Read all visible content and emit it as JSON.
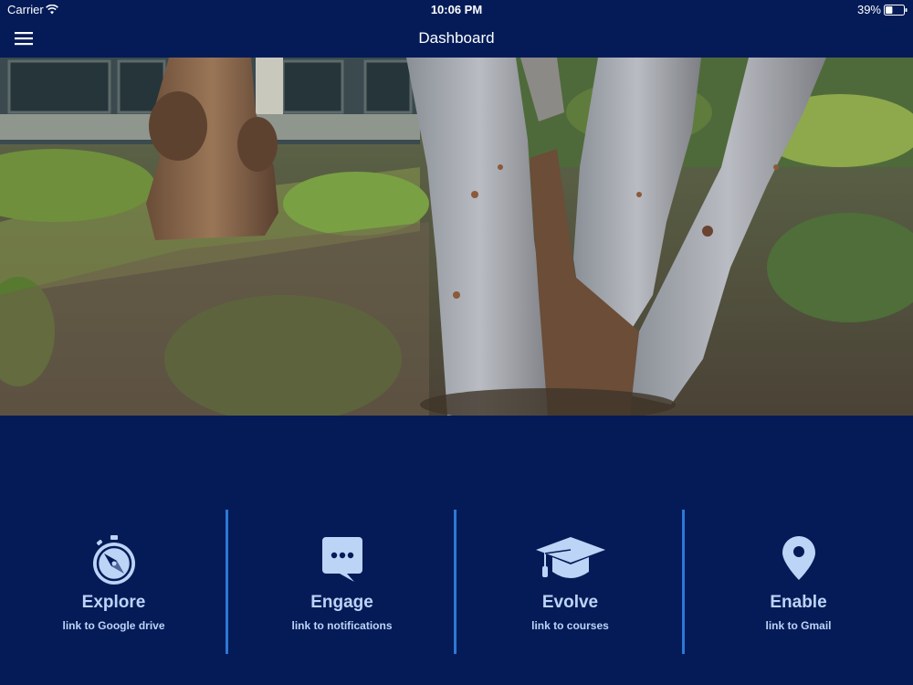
{
  "status_bar": {
    "carrier": "Carrier",
    "time": "10:06 PM",
    "battery_percent": "39%",
    "battery_level": 0.39
  },
  "nav": {
    "title": "Dashboard",
    "menu_icon": "hamburger-menu-icon"
  },
  "hero": {
    "description_icon": "campus-trees-photo"
  },
  "tiles": [
    {
      "title": "Explore",
      "subtitle": "link to Google drive",
      "icon": "compass-icon"
    },
    {
      "title": "Engage",
      "subtitle": "link to notifications",
      "icon": "chat-bubble-icon"
    },
    {
      "title": "Evolve",
      "subtitle": "link to courses",
      "icon": "graduation-cap-icon"
    },
    {
      "title": "Enable",
      "subtitle": "link to Gmail",
      "icon": "map-pin-icon"
    }
  ],
  "colors": {
    "background": "#041b57",
    "divider": "#2d78d6",
    "tile_text": "#bcd4f6"
  }
}
